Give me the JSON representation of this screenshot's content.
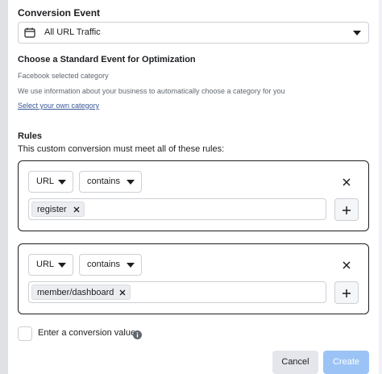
{
  "conversion_event": {
    "title": "Conversion Event",
    "selected": "All URL Traffic",
    "icon": "calendar-icon"
  },
  "optimization": {
    "title": "Choose a Standard Event for Optimization",
    "subtitle": "Facebook selected category",
    "description": "We use information about your business to automatically choose a category for you",
    "link": "Select your own category"
  },
  "rules": {
    "title": "Rules",
    "subtitle": "This custom conversion must meet all of these rules:",
    "items": [
      {
        "field": "URL",
        "operator": "contains",
        "values": [
          "register"
        ]
      },
      {
        "field": "URL",
        "operator": "contains",
        "values": [
          "member/dashboard"
        ]
      }
    ]
  },
  "conversion_value": {
    "label": "Enter a conversion value",
    "checked": false
  },
  "footer": {
    "cancel_label": "Cancel",
    "create_label": "Create"
  },
  "colors": {
    "primary_disabled": "#9cc3f5",
    "link": "#385898"
  }
}
